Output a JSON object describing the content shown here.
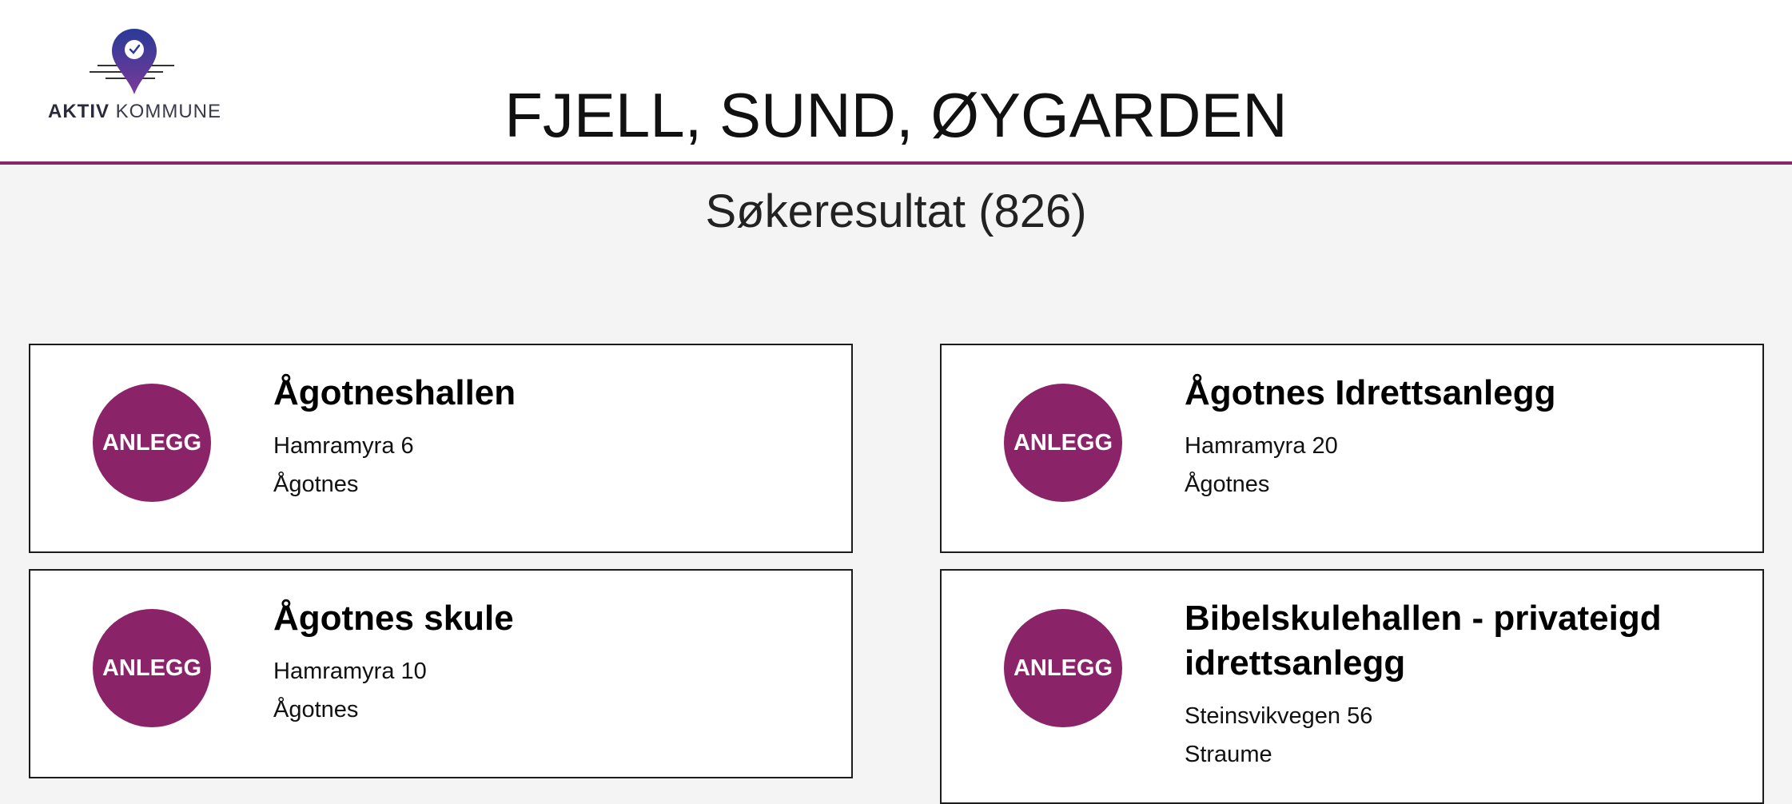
{
  "logo": {
    "strong": "AKTIV",
    "light": "KOMMUNE",
    "colors": {
      "pin_top": "#2a3a96",
      "pin_bottom": "#7a3a9a",
      "lines": "#333333"
    }
  },
  "header": {
    "title": "FJELL, SUND, ØYGARDEN",
    "accent": "#8b2368"
  },
  "results": {
    "heading": "Søkeresultat (826)"
  },
  "cards": [
    {
      "badge": "ANLEGG",
      "name": "Ågotneshallen",
      "address": "Hamramyra 6",
      "place": "Ågotnes"
    },
    {
      "badge": "ANLEGG",
      "name": "Ågotnes Idrettsanlegg",
      "address": "Hamramyra 20",
      "place": "Ågotnes"
    },
    {
      "badge": "ANLEGG",
      "name": "Ågotnes skule",
      "address": "Hamramyra 10",
      "place": "Ågotnes"
    },
    {
      "badge": "ANLEGG",
      "name": "Bibelskulehallen - privateigd idrettsanlegg",
      "address": "Steinsvikvegen 56",
      "place": "Straume"
    }
  ],
  "badge_color": "#8b2368"
}
